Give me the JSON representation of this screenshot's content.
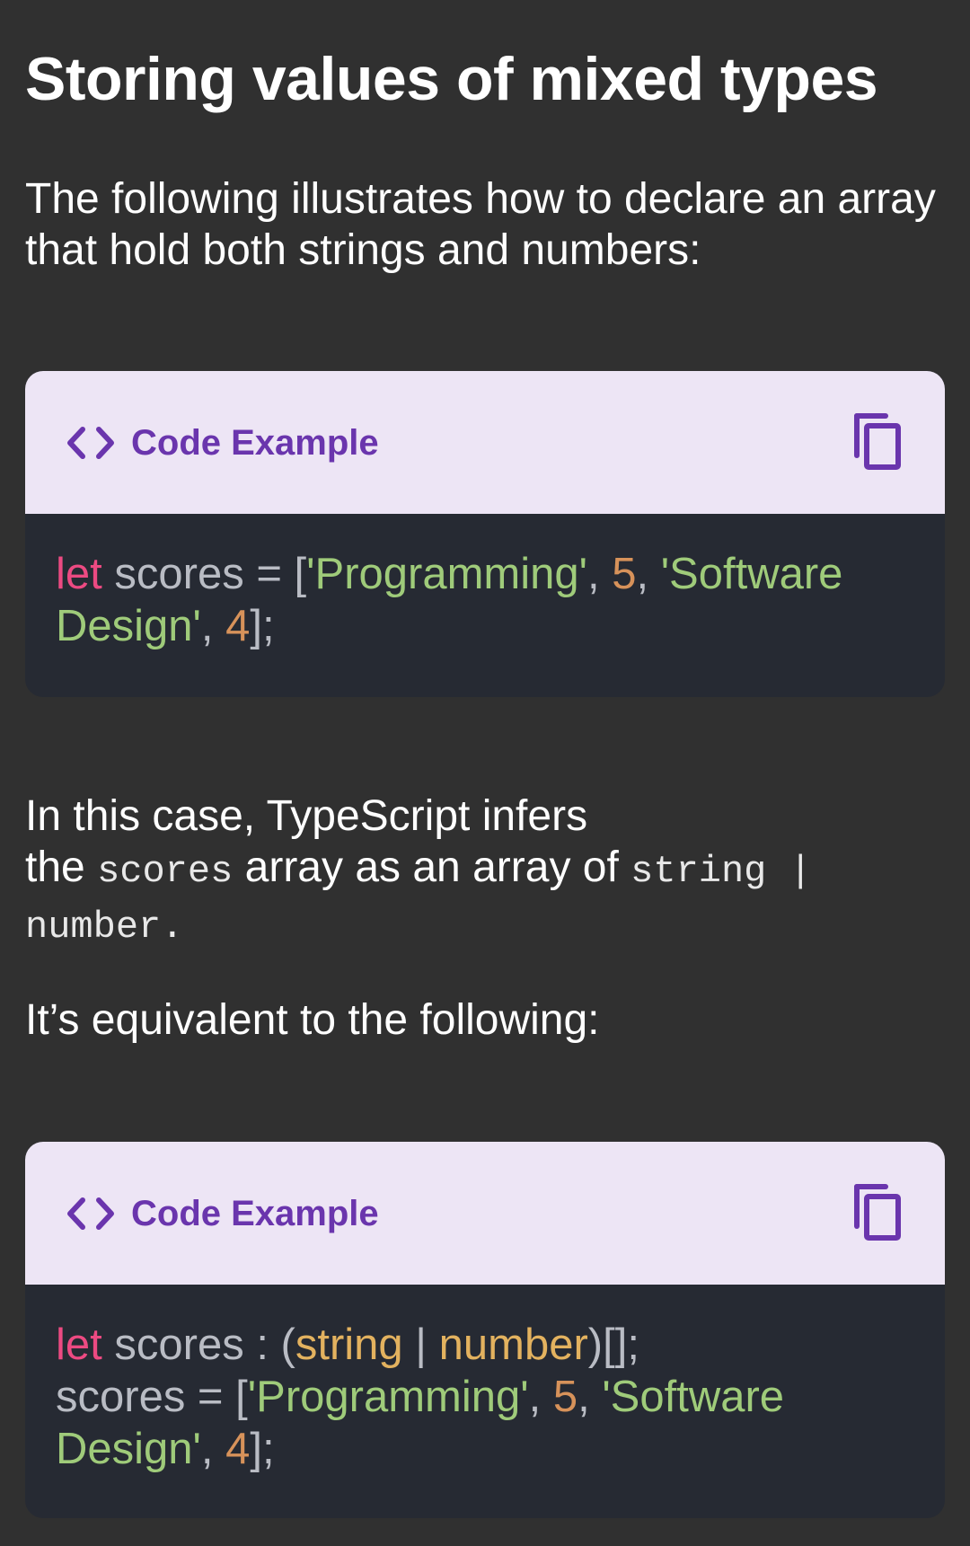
{
  "heading": "Storing values of mixed types",
  "intro_text": "The following illustrates how to declare an array that hold both strings and numbers:",
  "infer": {
    "part1": "In this case, TypeScript infers",
    "part2": "the ",
    "code1": "scores",
    "part3": " array as an array of ",
    "code2": "string |",
    "code3": "number",
    "part4": "."
  },
  "equivalent_text": "It’s equivalent to the following:",
  "code_examples": [
    {
      "title": "Code Example",
      "lines": [
        [
          {
            "t": "let",
            "c": "kw"
          },
          {
            "t": " scores = [",
            "c": "pun"
          },
          {
            "t": "'Programming'",
            "c": "str"
          },
          {
            "t": ", ",
            "c": "pun"
          },
          {
            "t": "5",
            "c": "num"
          },
          {
            "t": ", ",
            "c": "pun"
          },
          {
            "t": "'Software",
            "c": "str"
          }
        ],
        [
          {
            "t": "Design'",
            "c": "str"
          },
          {
            "t": ", ",
            "c": "pun"
          },
          {
            "t": "4",
            "c": "num"
          },
          {
            "t": "];",
            "c": "pun"
          }
        ]
      ]
    },
    {
      "title": "Code Example",
      "lines": [
        [
          {
            "t": "let",
            "c": "kw"
          },
          {
            "t": " scores : (",
            "c": "pun"
          },
          {
            "t": "string",
            "c": "typ"
          },
          {
            "t": " | ",
            "c": "pun"
          },
          {
            "t": "number",
            "c": "typ"
          },
          {
            "t": ")[];",
            "c": "pun"
          }
        ],
        [
          {
            "t": "scores = [",
            "c": "pun"
          },
          {
            "t": "'Programming'",
            "c": "str"
          },
          {
            "t": ", ",
            "c": "pun"
          },
          {
            "t": "5",
            "c": "num"
          },
          {
            "t": ", ",
            "c": "pun"
          },
          {
            "t": "'Software",
            "c": "str"
          }
        ],
        [
          {
            "t": "Design'",
            "c": "str"
          },
          {
            "t": ", ",
            "c": "pun"
          },
          {
            "t": "4",
            "c": "num"
          },
          {
            "t": "];",
            "c": "pun"
          }
        ]
      ]
    }
  ],
  "icons": {
    "code": "code-brackets-icon",
    "copy": "copy-icon"
  },
  "colors": {
    "background": "#303030",
    "card_header": "#ede5f5",
    "card_title": "#6a35ad",
    "code_background": "#262a33",
    "keyword": "#ec4a82",
    "string": "#9fcb7a",
    "number": "#d7925a",
    "type": "#e3b25f",
    "plain": "#b9bcc4"
  }
}
